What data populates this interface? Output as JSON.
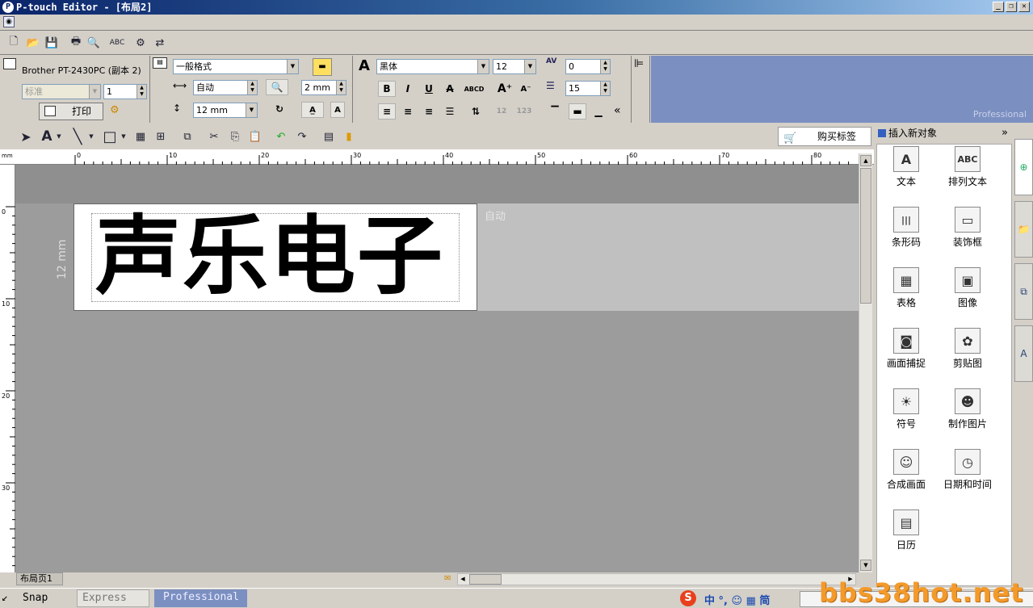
{
  "window": {
    "title": "P-touch Editor - [布局2]",
    "app_icon": "P"
  },
  "printer": {
    "name": "Brother PT-2430PC (副本 2)",
    "quality": "标准",
    "copies": "1",
    "print_label": "打印"
  },
  "format": {
    "style": "一般格式",
    "length": "自动",
    "margin": "2 mm",
    "width": "12 mm"
  },
  "font": {
    "name": "黑体",
    "size": "12",
    "char_spacing": "0",
    "line_spacing": "15"
  },
  "brand_label": "Professional",
  "toolbar2": {
    "buy_label": "购买标签"
  },
  "ruler": {
    "unit": "mm",
    "h_ticks": [
      "0",
      "10",
      "20",
      "30",
      "40",
      "50",
      "60",
      "70",
      "80"
    ],
    "v_ticks": [
      "0",
      "10",
      "20",
      "30"
    ]
  },
  "label": {
    "text": "声乐电子",
    "width_note": "12 mm",
    "length_note": "自动"
  },
  "page_tab": "布局页1",
  "insert_panel": {
    "title": "插入新对象",
    "items": [
      {
        "label": "文本",
        "icon": "text-icon",
        "glyph": "A"
      },
      {
        "label": "排列文本",
        "icon": "arranged-text-icon",
        "glyph": "ABC"
      },
      {
        "label": "条形码",
        "icon": "barcode-icon",
        "glyph": "|||"
      },
      {
        "label": "装饰框",
        "icon": "frame-icon",
        "glyph": "▭"
      },
      {
        "label": "表格",
        "icon": "table-icon",
        "glyph": "▦"
      },
      {
        "label": "图像",
        "icon": "image-icon",
        "glyph": "▣"
      },
      {
        "label": "画面捕捉",
        "icon": "screen-capture-icon",
        "glyph": "◙"
      },
      {
        "label": "剪贴图",
        "icon": "clipart-icon",
        "glyph": "✿"
      },
      {
        "label": "符号",
        "icon": "symbol-icon",
        "glyph": "☀"
      },
      {
        "label": "制作图片",
        "icon": "make-picture-icon",
        "glyph": "☻"
      },
      {
        "label": "合成画面",
        "icon": "composite-icon",
        "glyph": "☺"
      },
      {
        "label": "日期和时间",
        "icon": "clock-icon",
        "glyph": "◷"
      },
      {
        "label": "日历",
        "icon": "calendar-icon",
        "glyph": "▤"
      }
    ]
  },
  "taskbar": {
    "snap": "Snap",
    "express": "Express",
    "professional": "Professional",
    "ime": "中 °, ☺ ▦ 简",
    "watermark": "bbs38hot.net"
  },
  "colors": {
    "accent_blue": "#7b8fc1",
    "canvas_gray": "#9c9c9c",
    "title_dark": "#0a246a",
    "watermark_orange": "#f39a2a"
  }
}
